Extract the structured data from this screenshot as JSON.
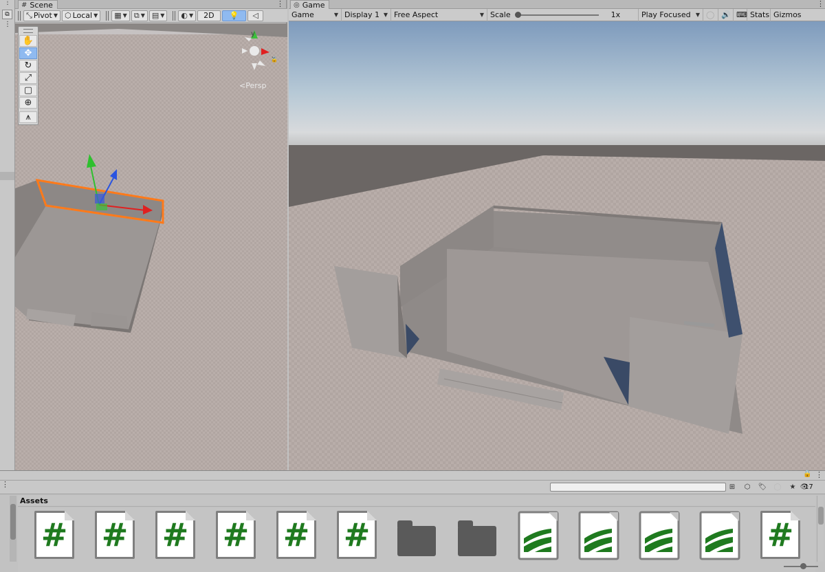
{
  "scene_tab": {
    "label": "Scene"
  },
  "game_tab": {
    "label": "Game"
  },
  "scene_toolbar": {
    "pivot_label": "Pivot",
    "local_label": "Local",
    "mode_2d_label": "2D"
  },
  "scene_view": {
    "persp_label": "Persp",
    "axis_x": "x",
    "axis_y": "y"
  },
  "tools": [
    "hand-tool",
    "move-tool",
    "rotate-tool",
    "scale-tool",
    "rect-tool",
    "transform-tool",
    "custom-tool"
  ],
  "game_toolbar": {
    "view_label": "Game",
    "display_label": "Display 1",
    "aspect_label": "Free Aspect",
    "scale_label": "Scale",
    "scale_value_label": "1x",
    "play_mode_label": "Play Focused",
    "stats_label": "Stats",
    "gizmos_label": "Gizmos"
  },
  "project": {
    "search_placeholder": "",
    "hidden_count": "17",
    "assets_header": "Assets",
    "assets": [
      {
        "type": "script"
      },
      {
        "type": "script"
      },
      {
        "type": "script"
      },
      {
        "type": "script"
      },
      {
        "type": "script"
      },
      {
        "type": "script"
      },
      {
        "type": "folder"
      },
      {
        "type": "folder"
      },
      {
        "type": "terrain"
      },
      {
        "type": "terrain"
      },
      {
        "type": "terrain"
      },
      {
        "type": "terrain"
      },
      {
        "type": "script"
      }
    ]
  },
  "colors": {
    "accent_blue": "#8fbaf0",
    "selection_orange": "#ff7a1a",
    "script_green": "#1f7a1f",
    "ground": "#b5aaa6",
    "sky_top": "#7e9bbd"
  }
}
